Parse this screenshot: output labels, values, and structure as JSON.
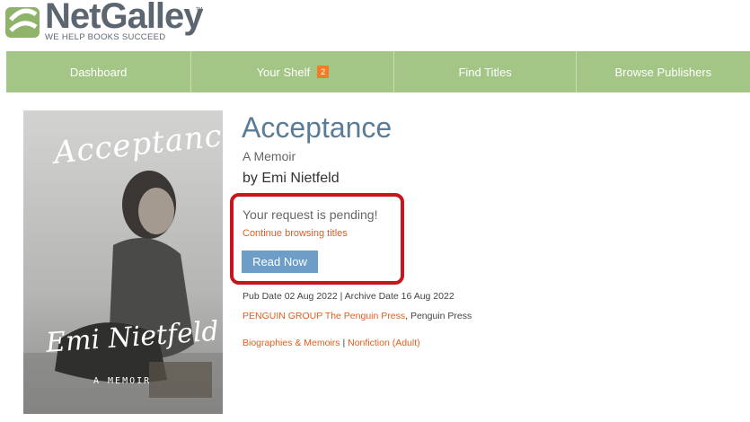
{
  "logo": {
    "name": "NetGalley",
    "trademark": "™",
    "tagline": "WE HELP BOOKS SUCCEED"
  },
  "nav": {
    "items": [
      {
        "label": "Dashboard"
      },
      {
        "label": "Your Shelf",
        "badge": "2"
      },
      {
        "label": "Find Titles"
      },
      {
        "label": "Browse Publishers"
      }
    ]
  },
  "book": {
    "cover": {
      "title": "Acceptance",
      "author": "Emi Nietfeld",
      "subtitle": "A MEMOIR"
    },
    "title": "Acceptance",
    "subtitle": "A Memoir",
    "author": "by Emi Nietfeld",
    "request_status": "Your request is pending!",
    "continue_link": "Continue browsing titles",
    "read_now": "Read Now",
    "dates": "Pub Date 02 Aug 2022 | Archive Date 16 Aug 2022",
    "publisher_link": "PENGUIN GROUP The Penguin Press",
    "publisher_sep": ", ",
    "imprint": "Penguin Press",
    "categories": [
      {
        "label": "Biographies & Memoirs"
      },
      {
        "label": "Nonfiction (Adult)"
      }
    ],
    "category_sep": " | "
  },
  "colors": {
    "nav_bg": "#a3c585",
    "badge": "#f07f24",
    "link": "#e35d1a",
    "title": "#5b7c96",
    "button": "#6c9ec7",
    "highlight": "#c4161c"
  }
}
